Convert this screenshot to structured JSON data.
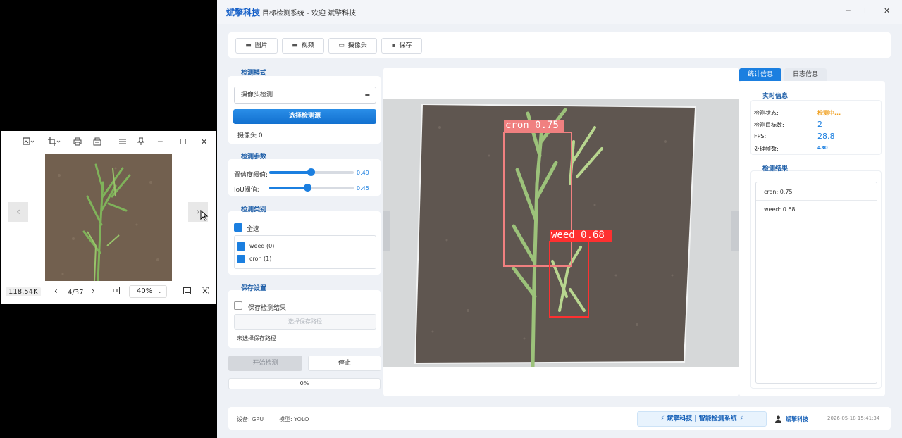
{
  "viewer": {
    "toolbar_icons": [
      "image-edit-icon",
      "crop-icon",
      "print-icon",
      "share-icon",
      "menu-icon",
      "pin-icon"
    ],
    "window_controls": [
      "─",
      "☐",
      "✕"
    ],
    "file_size": "118.54K",
    "page_indicator": "4/37",
    "zoom": "40%"
  },
  "app": {
    "name": "斌擎科技",
    "title": "目标检测系统 - 欢迎 斌擎科技",
    "window_controls": [
      "─",
      "☐",
      "✕"
    ],
    "toolbar": [
      {
        "label": "图片",
        "icon": "image-icon",
        "glyph": "▬"
      },
      {
        "label": "视频",
        "icon": "video-icon",
        "glyph": "▬"
      },
      {
        "label": "摄像头",
        "icon": "camera-icon",
        "glyph": "▭"
      },
      {
        "label": "保存",
        "icon": "save-icon",
        "glyph": "▪"
      }
    ],
    "mode": {
      "title": "检测模式",
      "selected": "摄像头检测",
      "select_source": "选择检测源",
      "source_info": "摄像头 0"
    },
    "params": {
      "title": "检测参数",
      "conf_label": "置信度阈值:",
      "conf_value": "0.49",
      "conf_fraction": 0.49,
      "iou_label": "IoU阈值:",
      "iou_value": "0.45",
      "iou_fraction": 0.45
    },
    "classes": {
      "title": "检测类别",
      "select_all": "全选",
      "items": [
        "weed (0)",
        "cron (1)"
      ]
    },
    "save": {
      "title": "保存设置",
      "save_results": "保存检测结果",
      "choose_path": "选择保存路径",
      "path_status": "未选择保存路径"
    },
    "actions": {
      "start": "开始检测",
      "stop": "停止",
      "progress": "0%",
      "progress_fraction": 0
    },
    "detections": [
      {
        "label": "cron 0.75",
        "color": "#f08080"
      },
      {
        "label": "weed 0.68",
        "color": "#ff3030"
      }
    ],
    "tabs": [
      "统计信息",
      "日志信息"
    ],
    "realtime": {
      "title": "实时信息",
      "rows": [
        {
          "label": "检测状态:",
          "value": "检测中...",
          "color": "#f0a020"
        },
        {
          "label": "检测目标数:",
          "value": "2",
          "color": "#1b7fe0"
        },
        {
          "label": "FPS:",
          "value": "28.8",
          "color": "#1b7fe0"
        },
        {
          "label": "处理帧数:",
          "value": "430",
          "color": "#1b7fe0"
        }
      ]
    },
    "results": {
      "title": "检测结果",
      "items": [
        "cron: 0.75",
        "weed: 0.68"
      ]
    },
    "status": {
      "device": "设备: GPU",
      "model": "模型: YOLO",
      "brand": "⚡ 斌擎科技 | 智能检测系统 ⚡",
      "user": "斌擎科技",
      "datetime": "2026-05-18 15:41:34"
    }
  }
}
